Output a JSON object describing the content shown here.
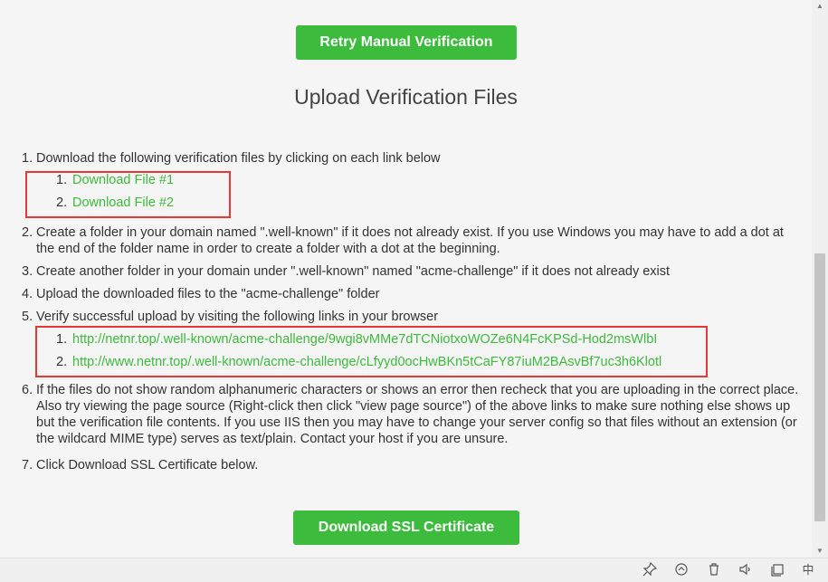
{
  "buttons": {
    "retry": "Retry Manual Verification",
    "download_ssl": "Download SSL Certificate"
  },
  "heading": "Upload Verification Files",
  "steps": [
    {
      "num": "1.",
      "text": "Download the following verification files by clicking on each link below"
    },
    {
      "num": "2.",
      "text": "Create a folder in your domain named \".well-known\" if it does not already exist. If you use Windows you may have to add a dot at the end of the folder name in order to create a folder with a dot at the beginning."
    },
    {
      "num": "3.",
      "text": "Create another folder in your domain under \".well-known\" named \"acme-challenge\" if it does not already exist"
    },
    {
      "num": "4.",
      "text": "Upload the downloaded files to the \"acme-challenge\" folder"
    },
    {
      "num": "5.",
      "text": "Verify successful upload by visiting the following links in your browser"
    },
    {
      "num": "6.",
      "text": "If the files do not show random alphanumeric characters or shows an error then recheck that you are uploading in the correct place. Also try viewing the page source (Right-click then click \"view page source\") of the above links to make sure nothing else shows up but the verification file contents. If you use IIS then you may have to change your server config so that files without an extension (or the wildcard MIME type) serves as text/plain. Contact your host if you are unsure."
    },
    {
      "num": "7.",
      "text": "Click Download SSL Certificate below."
    }
  ],
  "download_files": [
    {
      "num": "1.",
      "label": "Download File #1"
    },
    {
      "num": "2.",
      "label": "Download File #2"
    }
  ],
  "verify_links": [
    {
      "num": "1.",
      "url": "http://netnr.top/.well-known/acme-challenge/9wgi8vMMe7dTCNiotxoWOZe6N4FcKPSd-Hod2msWlbI"
    },
    {
      "num": "2.",
      "url": "http://www.netnr.top/.well-known/acme-challenge/cLfyyd0ocHwBKn5tCaFY87iuM2BAsvBf7uc3h6Klotl"
    }
  ],
  "colors": {
    "accent_green": "#3dbb3d",
    "highlight_red": "#e53935"
  },
  "taskbar_icons": [
    "pin-icon",
    "refresh-icon",
    "trash-icon",
    "speaker-icon",
    "window-icon",
    "input-method-icon"
  ],
  "taskbar_ime": "中"
}
